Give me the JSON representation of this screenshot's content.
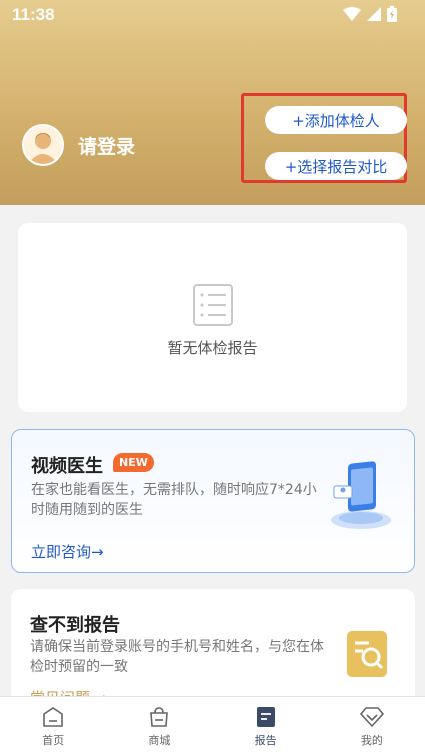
{
  "status_bar": {
    "time": "11:38"
  },
  "header": {
    "login_label": "请登录",
    "add_person_label": "+添加体检人",
    "compare_label": "+选择报告对比"
  },
  "empty_card": {
    "text": "暂无体检报告"
  },
  "video_card": {
    "title": "视频医生",
    "badge": "NEW",
    "desc": "在家也能看医生，无需排队，随时响应7*24小时随用随到的医生",
    "link": "立即咨询→"
  },
  "report_card": {
    "title": "查不到报告",
    "desc": "请确保当前登录账号的手机号和姓名，与您在体检时预留的一致",
    "link": "常见问题 →"
  },
  "tabbar": {
    "items": [
      {
        "label": "首页",
        "icon": "home-icon"
      },
      {
        "label": "商城",
        "icon": "shopping-bag-icon"
      },
      {
        "label": "报告",
        "icon": "report-icon"
      },
      {
        "label": "我的",
        "icon": "diamond-icon"
      }
    ],
    "active_index": 2
  },
  "colors": {
    "accent_blue": "#2058c9",
    "highlight_red": "#e03a2f",
    "gold": "#c9a15a",
    "badge_orange": "#f26a2e"
  }
}
